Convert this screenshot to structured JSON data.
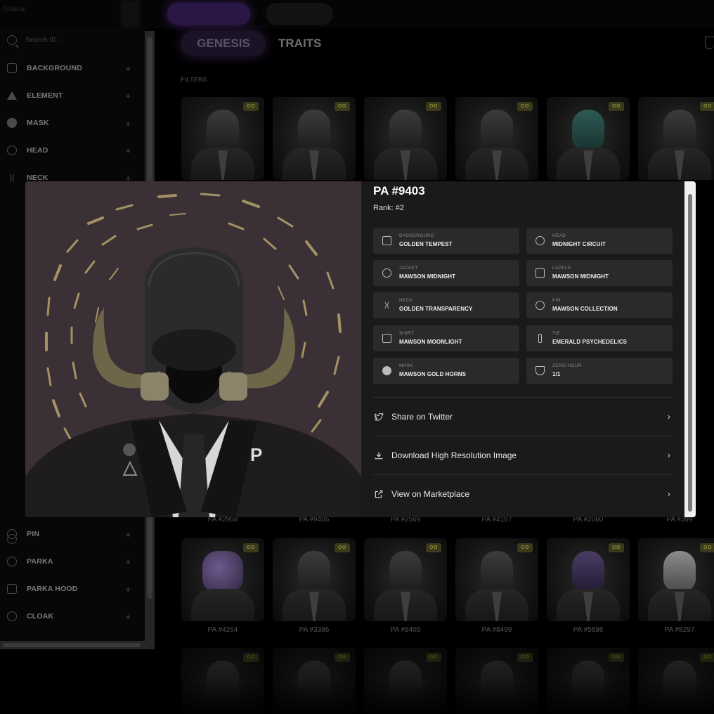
{
  "topbar": {
    "brand": "Solana"
  },
  "sidebar": {
    "search_placeholder": "Search ID...",
    "filters": [
      {
        "label": "BACKGROUND",
        "icon": "image-icon"
      },
      {
        "label": "ELEMENT",
        "icon": "triangle-icon"
      },
      {
        "label": "MASK",
        "icon": "mask-icon"
      },
      {
        "label": "HEAD",
        "icon": "head-icon"
      },
      {
        "label": "NECK",
        "icon": "neck-icon"
      }
    ],
    "filters_bottom": [
      {
        "label": "PIN",
        "icon": "pin-icon"
      },
      {
        "label": "PARKA",
        "icon": "parka-icon"
      },
      {
        "label": "PARKA HOOD",
        "icon": "hood-icon"
      },
      {
        "label": "CLOAK",
        "icon": "cloak-icon"
      }
    ]
  },
  "main": {
    "tabs": [
      {
        "label": "GENESIS",
        "active": true
      },
      {
        "label": "TRAITS",
        "active": false
      }
    ],
    "filters_label": "FILTERS",
    "row2_labels": [
      "PA #2958",
      "PA #9405",
      "PA #2569",
      "PA #4167",
      "PA #2060",
      "PA #399"
    ],
    "row3_labels": [
      "PA #4264",
      "PA #3386",
      "PA #9409",
      "PA #8499",
      "PA #5698",
      "PA #8297"
    ],
    "badge_text": "OO"
  },
  "modal": {
    "title": "PA #9403",
    "rank": "Rank: #2",
    "traits": [
      {
        "type": "BACKGROUND",
        "value": "GOLDEN TEMPEST",
        "icon": "image-icon"
      },
      {
        "type": "HEAD",
        "value": "MIDNIGHT CIRCUIT",
        "icon": "head-icon"
      },
      {
        "type": "JACKET",
        "value": "MAWSON MIDNIGHT",
        "icon": "jacket-icon"
      },
      {
        "type": "LAPELS",
        "value": "MAWSON MIDNIGHT",
        "icon": "lapels-icon"
      },
      {
        "type": "NECK",
        "value": "GOLDEN TRANSPARENCY",
        "icon": "neck-icon"
      },
      {
        "type": "PIN",
        "value": "MAWSON COLLECTION",
        "icon": "pin-icon"
      },
      {
        "type": "SHIRT",
        "value": "MAWSON MOONLIGHT",
        "icon": "shirt-icon"
      },
      {
        "type": "TIE",
        "value": "EMERALD PSYCHEDELICS",
        "icon": "tie-icon"
      },
      {
        "type": "MASK",
        "value": "MAWSON GOLD HORNS",
        "icon": "mask-icon"
      },
      {
        "type": "ZERO HOUR",
        "value": "1/1",
        "icon": "trophy-icon"
      }
    ],
    "actions": [
      {
        "label": "Share on Twitter",
        "icon": "twitter-icon"
      },
      {
        "label": "Download High Resolution Image",
        "icon": "download-icon"
      },
      {
        "label": "View on Marketplace",
        "icon": "external-link-icon"
      }
    ]
  },
  "colors": {
    "background": "#000000",
    "panel": "#1a1a1a",
    "trait_card": "#2a2a2a",
    "art_background": "#3a3036",
    "accent_gold": "#b8a46a",
    "active_tab": "#2b1745"
  }
}
